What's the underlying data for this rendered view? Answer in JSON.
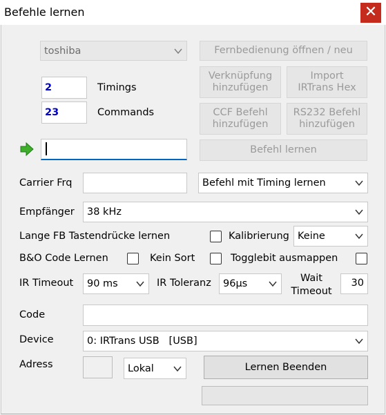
{
  "window": {
    "title": "Befehle lernen",
    "close": "✕"
  },
  "remote": {
    "selected": "toshiba"
  },
  "buttons": {
    "open_remote": "Fernbedienung öffnen / neu",
    "add_link": [
      "Verknüpfung",
      "hinzufügen"
    ],
    "import_irtrans": [
      "Import",
      "IRTrans Hex"
    ],
    "add_ccf": [
      "CCF Befehl",
      "hinzufügen"
    ],
    "add_rs232": [
      "RS232 Befehl",
      "hinzufügen"
    ],
    "learn_command": "Befehl lernen",
    "stop_learning": "Lernen Beenden"
  },
  "counts": {
    "timings_value": "2",
    "timings_label": "Timings",
    "commands_value": "23",
    "commands_label": "Commands"
  },
  "command_input": {
    "value": ""
  },
  "carrier": {
    "label": "Carrier Frq",
    "value": "",
    "mode": "Befehl mit Timing lernen"
  },
  "receiver": {
    "label": "Empfänger",
    "value": "38 kHz"
  },
  "options": {
    "long_press": "Lange FB Tastendrücke lernen",
    "calibration": "Kalibrierung",
    "calibration_value": "Keine",
    "bo_code": "B&O Code Lernen",
    "no_sort": "Kein Sort",
    "togglebit": "Togglebit ausmappen"
  },
  "timeouts": {
    "ir_timeout_label": "IR Timeout",
    "ir_timeout_value": "90 ms",
    "ir_tolerance_label": "IR Toleranz",
    "ir_tolerance_value": "96µs",
    "wait_timeout_label": [
      "Wait",
      "Timeout"
    ],
    "wait_timeout_value": "30"
  },
  "code": {
    "label": "Code",
    "value": ""
  },
  "device": {
    "label": "Device",
    "value": "0: IRTrans USB   [USB]"
  },
  "address": {
    "label": "Adress",
    "value": "",
    "scope": "Lokal"
  },
  "progress": {
    "fraction": 0
  }
}
